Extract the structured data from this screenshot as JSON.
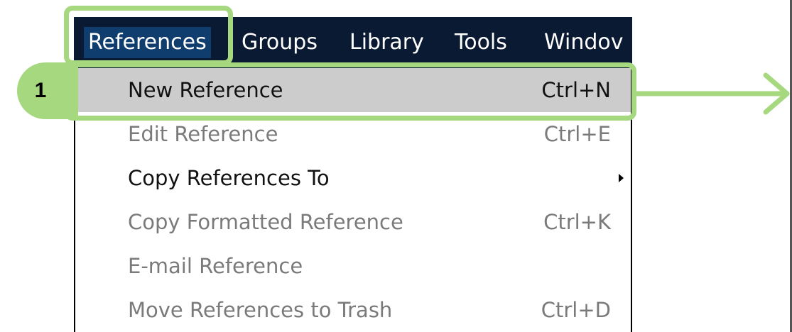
{
  "menubar": {
    "items": [
      {
        "label": "References",
        "active": true
      },
      {
        "label": "Groups"
      },
      {
        "label": "Library"
      },
      {
        "label": "Tools"
      },
      {
        "label": "Windov"
      }
    ]
  },
  "menu": {
    "items": [
      {
        "label": "New Reference",
        "shortcut": "Ctrl+N",
        "state": "enabled",
        "highlighted": true
      },
      {
        "label": "Edit Reference",
        "shortcut": "Ctrl+E",
        "state": "disabled"
      },
      {
        "label": "Copy References To",
        "shortcut": "",
        "state": "enabled",
        "submenu": true
      },
      {
        "label": "Copy Formatted Reference",
        "shortcut": "Ctrl+K",
        "state": "disabled"
      },
      {
        "label": "E-mail Reference",
        "shortcut": "",
        "state": "disabled"
      },
      {
        "label": "Move References to Trash",
        "shortcut": "Ctrl+D",
        "state": "disabled"
      }
    ]
  },
  "annotation": {
    "step_number": "1",
    "highlight_color": "#a6d880"
  },
  "colors": {
    "menubar_bg": "#0a1a32",
    "menubar_active_bg": "#0f3d6e",
    "menu_highlight": "#cccccc",
    "disabled_text": "#7a7a7a"
  },
  "icons": {
    "submenu": "chevron-right-icon",
    "callout_arrow": "arrow-right-icon"
  }
}
